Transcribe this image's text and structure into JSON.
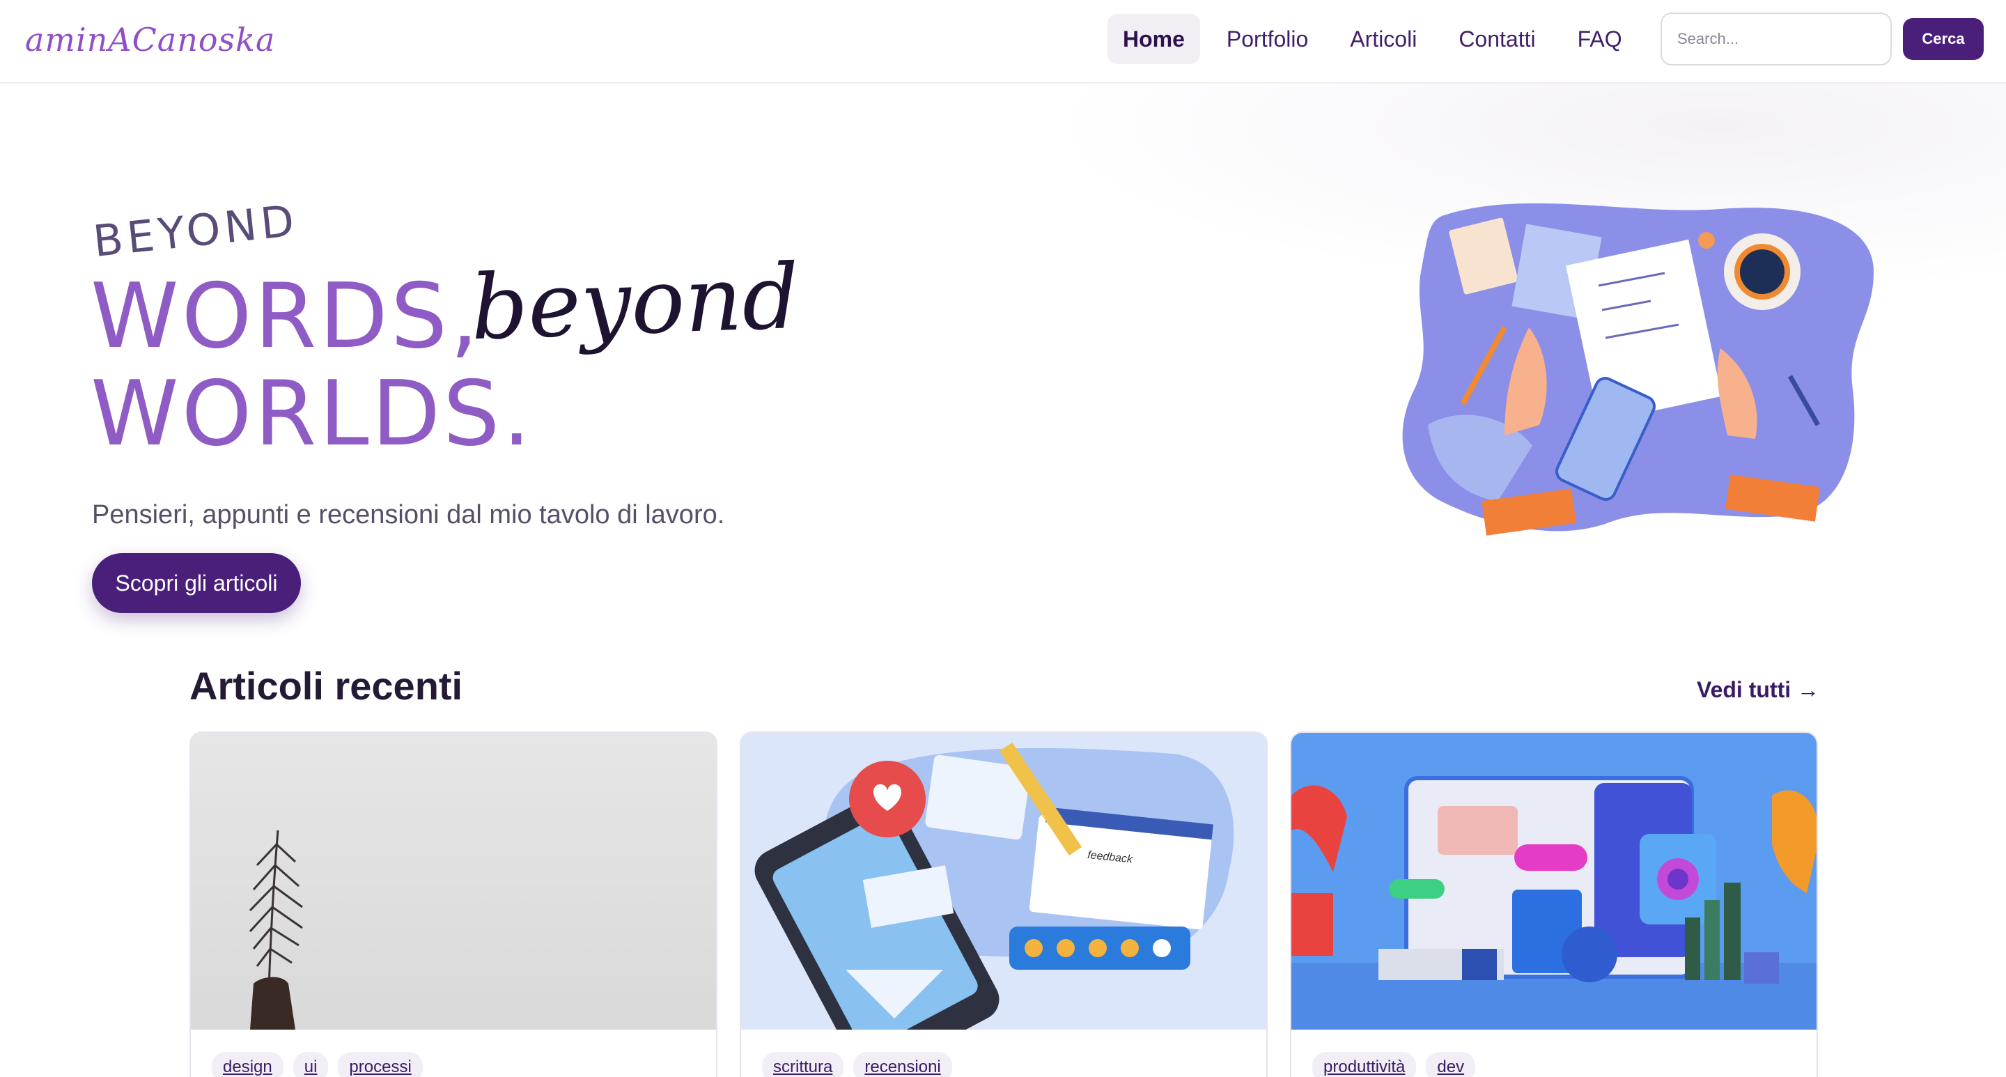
{
  "brand": {
    "logo": "aminACanoska"
  },
  "nav": {
    "links": [
      {
        "label": "Home",
        "active": true
      },
      {
        "label": "Portfolio",
        "active": false
      },
      {
        "label": "Articoli",
        "active": false
      },
      {
        "label": "Contatti",
        "active": false
      },
      {
        "label": "FAQ",
        "active": false
      }
    ],
    "search": {
      "placeholder": "Search...",
      "value": ""
    },
    "search_button": "Cerca"
  },
  "hero": {
    "title_small": "BEYOND",
    "title_words": "WORDS,",
    "title_script": "beyond",
    "title_worlds": "WORLDS.",
    "subtitle": "Pensieri, appunti e recensioni dal mio tavolo di lavoro.",
    "cta": "Scopri gli articoli"
  },
  "recent": {
    "title": "Articoli recenti",
    "see_all": "Vedi tutti →",
    "cards": [
      {
        "tags": [
          "design",
          "ui",
          "processi"
        ]
      },
      {
        "tags": [
          "scrittura",
          "recensioni"
        ],
        "image_text": "feedback"
      },
      {
        "tags": [
          "produttività",
          "dev"
        ]
      }
    ]
  },
  "colors": {
    "primary": "#4a1f7a",
    "accent": "#8f5bc4",
    "text": "#251a36"
  }
}
